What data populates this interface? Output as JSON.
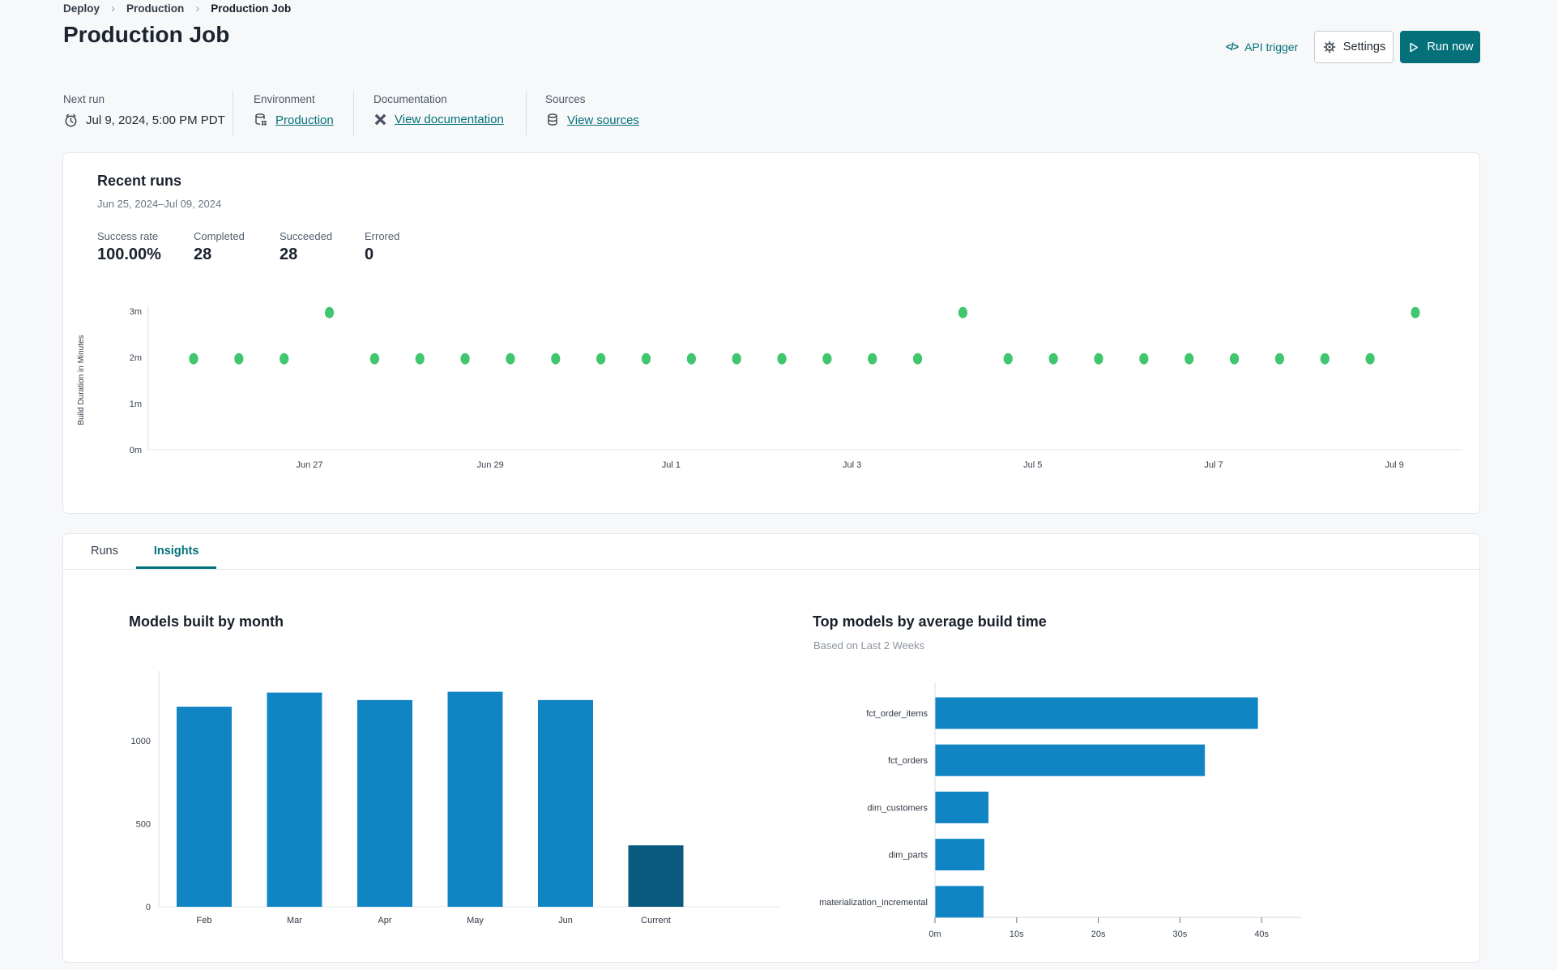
{
  "breadcrumb": {
    "separator": "›",
    "items": [
      {
        "label": "Deploy"
      },
      {
        "label": "Production"
      },
      {
        "label": "Production Job"
      }
    ]
  },
  "header": {
    "title": "Production Job",
    "api_trigger_icon": "</>",
    "api_trigger_label": "API trigger",
    "settings_label": "Settings",
    "run_now_label": "Run now"
  },
  "meta": {
    "next_run": {
      "label": "Next run",
      "value": "Jul 9, 2024, 5:00 PM PDT"
    },
    "environment": {
      "label": "Environment",
      "value": "Production"
    },
    "documentation": {
      "label": "Documentation",
      "value": "View documentation"
    },
    "sources": {
      "label": "Sources",
      "value": "View sources"
    }
  },
  "recent_runs": {
    "title": "Recent runs",
    "date_range": "Jun 25, 2024–Jul 09, 2024",
    "stats": [
      {
        "label": "Success rate",
        "value": "100.00%"
      },
      {
        "label": "Completed",
        "value": "28"
      },
      {
        "label": "Succeeded",
        "value": "28"
      },
      {
        "label": "Errored",
        "value": "0"
      }
    ]
  },
  "tabs": [
    {
      "label": "Runs",
      "active": false
    },
    {
      "label": "Insights",
      "active": true
    }
  ],
  "colors": {
    "teal": "#04717a",
    "run_dot_green": "#3fc66e",
    "bar_blue": "#1185c4",
    "bar_dark_blue": "#0a5a80"
  },
  "chart_data": [
    {
      "name": "recent_runs_build_duration",
      "type": "scatter",
      "ylabel": "Build Duration in Minutes",
      "yticks": [
        "0m",
        "1m",
        "2m",
        "3m"
      ],
      "ylim_minutes": [
        0,
        3.3
      ],
      "xticks": [
        "Jun 27",
        "Jun 29",
        "Jul 1",
        "Jul 3",
        "Jul 5",
        "Jul 7",
        "Jul 9"
      ],
      "point_color": "#3fc66e",
      "n_points": 28,
      "durations_minutes": [
        1.97,
        1.97,
        1.97,
        2.97,
        1.97,
        1.97,
        1.97,
        1.97,
        1.97,
        1.97,
        1.97,
        1.97,
        1.97,
        1.97,
        1.97,
        1.97,
        1.97,
        2.97,
        1.97,
        1.97,
        1.97,
        1.97,
        1.97,
        1.97,
        1.97,
        1.97,
        1.97,
        2.97
      ]
    },
    {
      "name": "models_built_by_month",
      "type": "bar",
      "title": "Models built by month",
      "categories": [
        "Feb",
        "Mar",
        "Apr",
        "May",
        "Jun",
        "Current"
      ],
      "values": [
        1205,
        1290,
        1245,
        1295,
        1245,
        370
      ],
      "bar_colors": [
        "#1185c4",
        "#1185c4",
        "#1185c4",
        "#1185c4",
        "#1185c4",
        "#0a5a80"
      ],
      "yticks": [
        0,
        500,
        1000
      ],
      "ylim": [
        0,
        1420
      ],
      "grid": false
    },
    {
      "name": "top_models_by_average_build_time",
      "type": "bar",
      "orientation": "horizontal",
      "title": "Top models by average build time",
      "subtitle": "Based on Last 2 Weeks",
      "categories": [
        "fct_order_items",
        "fct_orders",
        "dim_customers",
        "dim_parts",
        "materialization_incremental"
      ],
      "values_seconds": [
        39.5,
        33,
        6.5,
        6,
        5.9
      ],
      "xticks": [
        {
          "value": 0,
          "label": "0m"
        },
        {
          "value": 10,
          "label": "10s"
        },
        {
          "value": 20,
          "label": "20s"
        },
        {
          "value": 30,
          "label": "30s"
        },
        {
          "value": 40,
          "label": "40s"
        }
      ],
      "xlim_seconds": [
        0,
        44
      ],
      "bar_color": "#1185c4",
      "grid": false
    }
  ]
}
